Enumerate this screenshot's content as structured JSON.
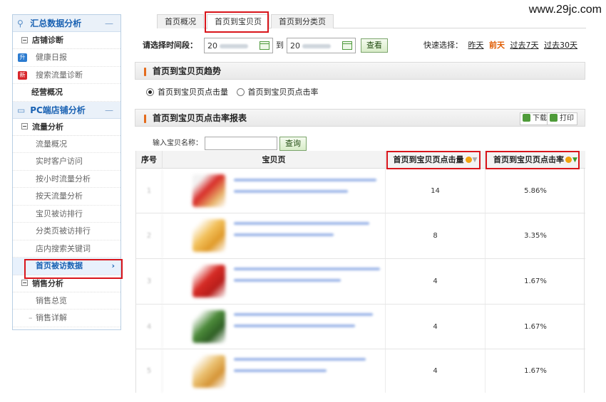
{
  "watermark": "www.29jc.com",
  "sidebar": {
    "group1": {
      "label": "汇总数据分析",
      "collapse": "—"
    },
    "diagnosis": {
      "label": "店铺诊断",
      "toggle": "⊟"
    },
    "health": {
      "label": "健康日报",
      "tag": "升",
      "tag_color": "#2b7bd0"
    },
    "search_diag": {
      "label": "搜索流量诊断",
      "tag": "新",
      "tag_color": "#d8262b"
    },
    "overview": {
      "label": "经营概况"
    },
    "group2": {
      "label": "PC端店铺分析",
      "collapse": "—"
    },
    "traffic": {
      "label": "流量分析",
      "toggle": "⊟"
    },
    "traffic_items": [
      "流量概况",
      "实时客户访问",
      "按小时流量分析",
      "按天流量分析",
      "宝贝被访排行",
      "分类页被访排行",
      "店内搜索关键词"
    ],
    "homepage_visits": {
      "label": "首页被访数据",
      "arrow": "›"
    },
    "sales": {
      "label": "销售分析",
      "toggle": "⊟"
    },
    "sales_items": [
      "销售总览",
      "销售详解"
    ]
  },
  "tabs": [
    "首页概况",
    "首页到宝贝页",
    "首页到分类页"
  ],
  "daterow": {
    "label": "请选择时间段：",
    "start_prefix": "20",
    "end_prefix": "20",
    "to": "到",
    "view_button": "查看",
    "quick_label": "快速选择：",
    "quick": [
      "昨天",
      "前天",
      "过去7天",
      "过去30天"
    ]
  },
  "trend": {
    "title": "首页到宝贝页趋势",
    "radio_clicks": "首页到宝贝页点击量",
    "radio_rate": "首页到宝贝页点击率"
  },
  "report": {
    "title": "首页到宝贝页点击率报表",
    "download": "下载",
    "print": "打印",
    "search_label": "输入宝贝名称：",
    "search_button": "查询",
    "columns": [
      "序号",
      "宝贝页",
      "首页到宝贝页点击量",
      "首页到宝贝页点击率"
    ],
    "rows": [
      {
        "seq": "1",
        "clicks": "14",
        "rate": "5.86%"
      },
      {
        "seq": "2",
        "clicks": "8",
        "rate": "3.35%"
      },
      {
        "seq": "3",
        "clicks": "4",
        "rate": "1.67%"
      },
      {
        "seq": "4",
        "clicks": "4",
        "rate": "1.67%"
      },
      {
        "seq": "5",
        "clicks": "4",
        "rate": "1.67%"
      }
    ]
  },
  "colors": {
    "accent": "#1a62b3",
    "highlight_border": "#d9151b",
    "section_bar": "#e46b1c"
  }
}
